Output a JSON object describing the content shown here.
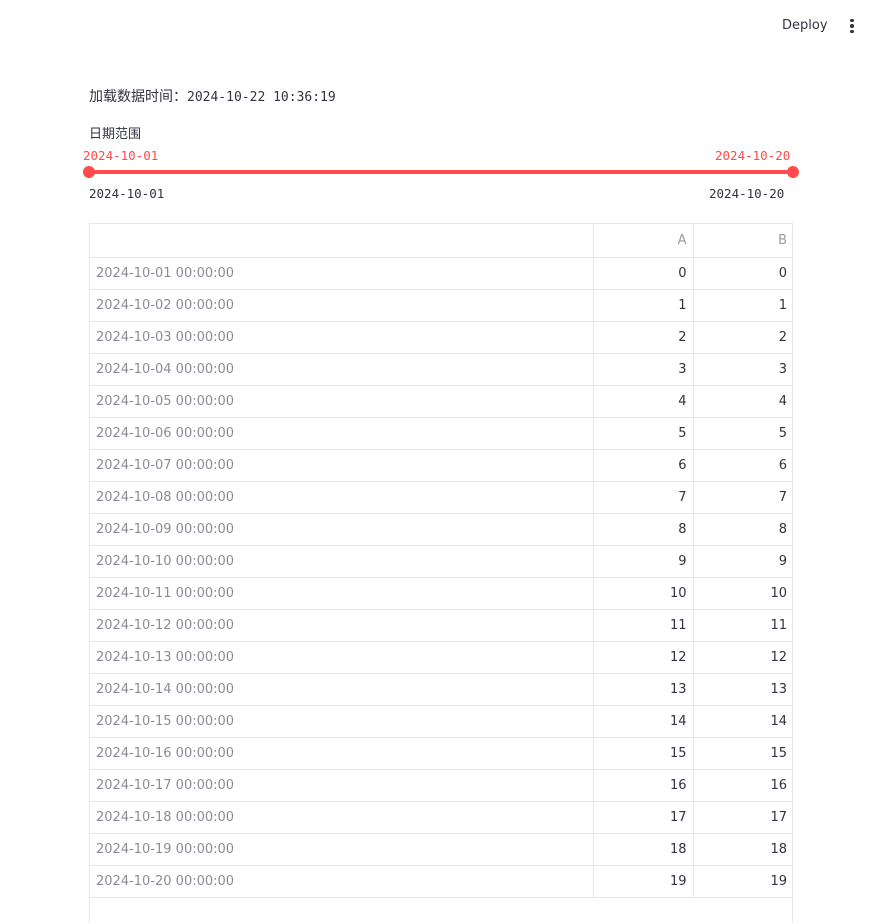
{
  "toolbar": {
    "deploy_label": "Deploy",
    "menu_icon": "vertical-ellipsis-icon"
  },
  "load_time": {
    "label": "加载数据时间：",
    "value": "2024-10-22 10:36:19"
  },
  "slider": {
    "label": "日期范围",
    "selected_start": "2024-10-01",
    "selected_end": "2024-10-20",
    "min": "2024-10-01",
    "max": "2024-10-20",
    "accent_color": "#ff4b4b"
  },
  "table": {
    "columns": [
      "",
      "A",
      "B"
    ],
    "rows": [
      {
        "index": "2024-10-01 00:00:00",
        "A": "0",
        "B": "0"
      },
      {
        "index": "2024-10-02 00:00:00",
        "A": "1",
        "B": "1"
      },
      {
        "index": "2024-10-03 00:00:00",
        "A": "2",
        "B": "2"
      },
      {
        "index": "2024-10-04 00:00:00",
        "A": "3",
        "B": "3"
      },
      {
        "index": "2024-10-05 00:00:00",
        "A": "4",
        "B": "4"
      },
      {
        "index": "2024-10-06 00:00:00",
        "A": "5",
        "B": "5"
      },
      {
        "index": "2024-10-07 00:00:00",
        "A": "6",
        "B": "6"
      },
      {
        "index": "2024-10-08 00:00:00",
        "A": "7",
        "B": "7"
      },
      {
        "index": "2024-10-09 00:00:00",
        "A": "8",
        "B": "8"
      },
      {
        "index": "2024-10-10 00:00:00",
        "A": "9",
        "B": "9"
      },
      {
        "index": "2024-10-11 00:00:00",
        "A": "10",
        "B": "10"
      },
      {
        "index": "2024-10-12 00:00:00",
        "A": "11",
        "B": "11"
      },
      {
        "index": "2024-10-13 00:00:00",
        "A": "12",
        "B": "12"
      },
      {
        "index": "2024-10-14 00:00:00",
        "A": "13",
        "B": "13"
      },
      {
        "index": "2024-10-15 00:00:00",
        "A": "14",
        "B": "14"
      },
      {
        "index": "2024-10-16 00:00:00",
        "A": "15",
        "B": "15"
      },
      {
        "index": "2024-10-17 00:00:00",
        "A": "16",
        "B": "16"
      },
      {
        "index": "2024-10-18 00:00:00",
        "A": "17",
        "B": "17"
      },
      {
        "index": "2024-10-19 00:00:00",
        "A": "18",
        "B": "18"
      },
      {
        "index": "2024-10-20 00:00:00",
        "A": "19",
        "B": "19"
      }
    ]
  }
}
